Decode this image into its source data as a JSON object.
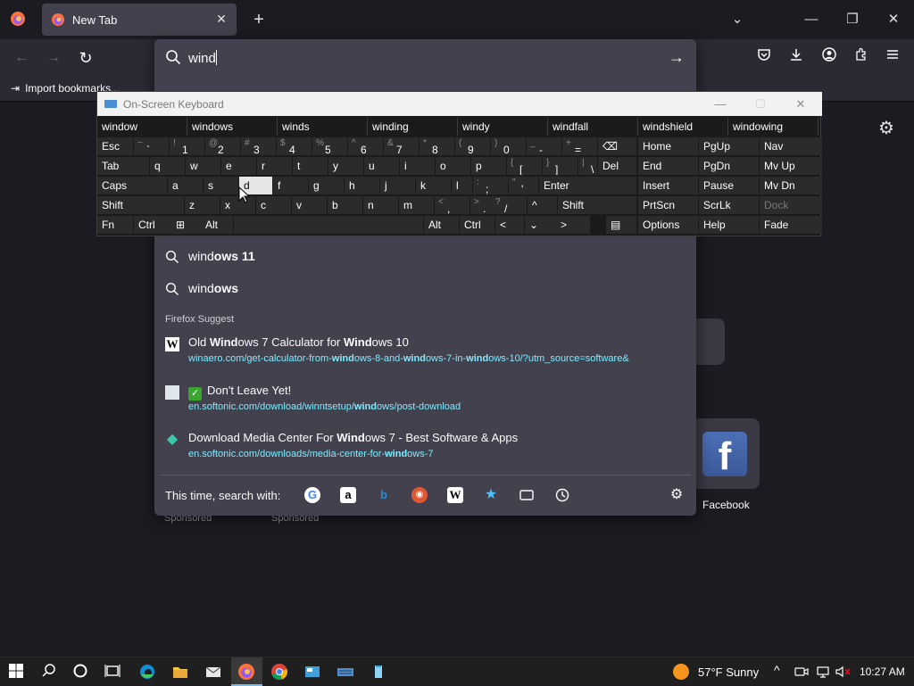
{
  "tab": {
    "title": "New Tab",
    "close": "✕",
    "new": "+"
  },
  "window": {
    "list_tabs": "⌄",
    "minimize": "—",
    "maximize": "❐",
    "close": "✕"
  },
  "nav": {
    "back": "←",
    "forward": "→",
    "reload": "↻"
  },
  "bookmarks": {
    "import_label": "Import bookmarks..."
  },
  "url": {
    "value": "wind",
    "go": "→"
  },
  "suggestions": [
    {
      "typed": "wind",
      "completion": "ows 11"
    },
    {
      "typed": "wind",
      "completion": "ows"
    }
  ],
  "firefox_suggest": {
    "heading": "Firefox Suggest",
    "items": [
      {
        "favicon": "W",
        "title": "Old Windows 7 Calculator for Windows 10",
        "url": "winaero.com/get-calculator-from-windows-8-and-windows-7-in-windows-10/?utm_source=software&"
      },
      {
        "favicon": "",
        "check": "✓",
        "title": "Don't Leave Yet!",
        "url": "en.softonic.com/download/winntsetup/windows/post-download"
      },
      {
        "favicon": "◆",
        "title": "Download Media Center For Windows 7 - Best Software & Apps",
        "url": "en.softonic.com/downloads/media-center-for-windows-7"
      }
    ]
  },
  "search_with": {
    "label": "This time, search with:",
    "engines": [
      "google-icon",
      "amazon-icon",
      "bing-icon",
      "duckduckgo-icon",
      "wikipedia-icon",
      "bookmarks-icon",
      "tabs-icon",
      "history-icon"
    ]
  },
  "osk": {
    "title": "On-Screen Keyboard",
    "minimize": "—",
    "maximize": "☐",
    "close": "✕",
    "predictions": [
      "window",
      "windows",
      "winds",
      "winding",
      "windy",
      "windfall",
      "windshield",
      "windowing"
    ],
    "row1": [
      {
        "main": "Esc"
      },
      {
        "shift": "~",
        "main": "`"
      },
      {
        "shift": "!",
        "main": "1"
      },
      {
        "shift": "@",
        "main": "2"
      },
      {
        "shift": "#",
        "main": "3"
      },
      {
        "shift": "$",
        "main": "4"
      },
      {
        "shift": "%",
        "main": "5"
      },
      {
        "shift": "^",
        "main": "6"
      },
      {
        "shift": "&",
        "main": "7"
      },
      {
        "shift": "*",
        "main": "8"
      },
      {
        "shift": "(",
        "main": "9"
      },
      {
        "shift": ")",
        "main": "0"
      },
      {
        "shift": "_",
        "main": "-"
      },
      {
        "shift": "+",
        "main": "="
      },
      {
        "main": "⌫"
      }
    ],
    "row2": [
      {
        "main": "Tab"
      },
      {
        "main": "q"
      },
      {
        "main": "w"
      },
      {
        "main": "e"
      },
      {
        "main": "r"
      },
      {
        "main": "t"
      },
      {
        "main": "y"
      },
      {
        "main": "u"
      },
      {
        "main": "i"
      },
      {
        "main": "o"
      },
      {
        "main": "p"
      },
      {
        "shift": "{",
        "main": "["
      },
      {
        "shift": "}",
        "main": "]"
      },
      {
        "shift": "|",
        "main": "\\"
      },
      {
        "main": "Del"
      }
    ],
    "row3": [
      {
        "main": "Caps"
      },
      {
        "main": "a"
      },
      {
        "main": "s"
      },
      {
        "main": "d"
      },
      {
        "main": "f"
      },
      {
        "main": "g"
      },
      {
        "main": "h"
      },
      {
        "main": "j"
      },
      {
        "main": "k"
      },
      {
        "main": "l"
      },
      {
        "shift": ":",
        "main": ";"
      },
      {
        "shift": "\"",
        "main": "'"
      },
      {
        "main": "Enter"
      }
    ],
    "row4": [
      {
        "main": "Shift"
      },
      {
        "main": "z"
      },
      {
        "main": "x"
      },
      {
        "main": "c"
      },
      {
        "main": "v"
      },
      {
        "main": "b"
      },
      {
        "main": "n"
      },
      {
        "main": "m"
      },
      {
        "shift": "<",
        "main": ","
      },
      {
        "shift": ">",
        "main": "."
      },
      {
        "shift": "?",
        "main": "/"
      },
      {
        "main": "^"
      },
      {
        "main": "Shift"
      }
    ],
    "row5": [
      {
        "main": "Fn"
      },
      {
        "main": "Ctrl"
      },
      {
        "main": "⊞"
      },
      {
        "main": "Alt"
      },
      {
        "main": ""
      },
      {
        "main": "Alt"
      },
      {
        "main": "Ctrl"
      },
      {
        "main": "<"
      },
      {
        "main": "⌄"
      },
      {
        "main": ">"
      },
      {
        "main": "▤"
      }
    ],
    "nav_keys": [
      [
        "Home",
        "PgUp",
        "Nav"
      ],
      [
        "End",
        "PgDn",
        "Mv Up"
      ],
      [
        "Insert",
        "Pause",
        "Mv Dn"
      ],
      [
        "PrtScn",
        "ScrLk",
        "Dock"
      ],
      [
        "Options",
        "Help",
        "Fade"
      ]
    ]
  },
  "newtab": {
    "facebook_label": "Facebook",
    "sponsored": "Sponsored"
  },
  "taskbar": {
    "weather": "57°F  Sunny",
    "time": "10:27 AM",
    "tray_up": "^"
  },
  "colors": {
    "accent": "#0060df",
    "url_link": "#80ebff",
    "panel_bg": "#42414d",
    "window_bg": "#1c1b22"
  }
}
